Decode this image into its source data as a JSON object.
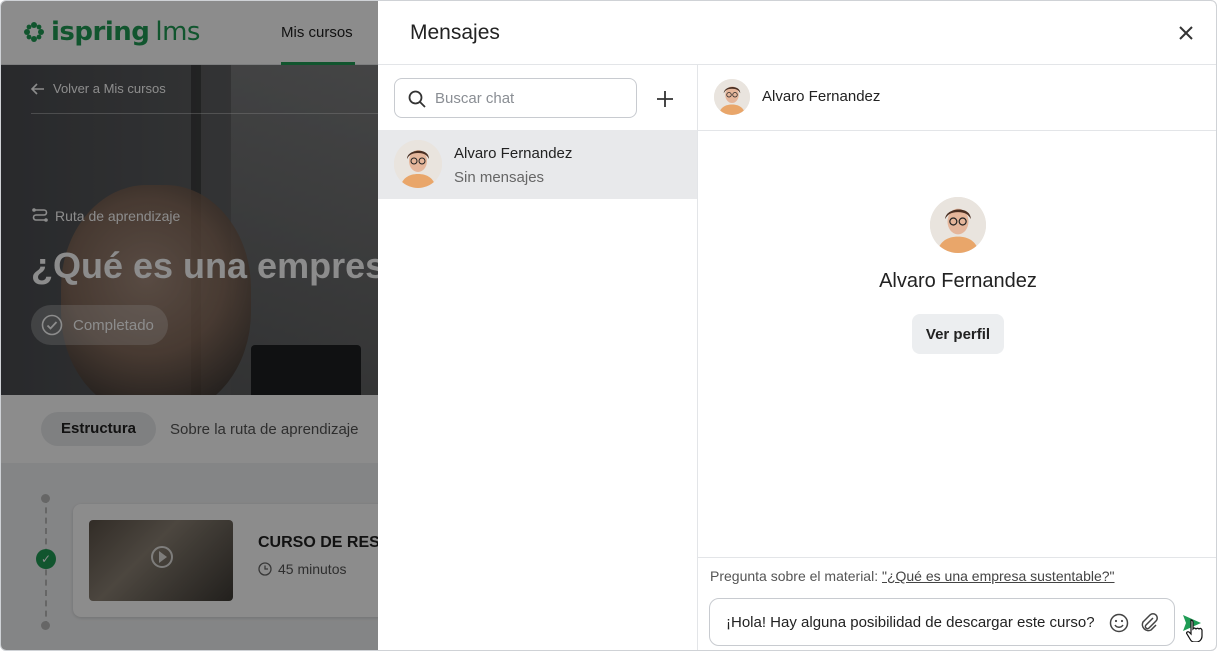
{
  "colors": {
    "brand": "#1f9c55",
    "send": "#1f9c55",
    "overlay": "rgba(0,0,0,0.45)"
  },
  "background": {
    "logo": {
      "name": "ispring",
      "suffix": "lms"
    },
    "nav": {
      "my_courses": "Mis cursos"
    },
    "hero": {
      "back_label": "Volver a Mis cursos",
      "route_label": "Ruta de aprendizaje",
      "title": "¿Qué es una empresa",
      "status": "Completado"
    },
    "tabs": {
      "structure": "Estructura",
      "about": "Sobre la ruta de aprendizaje"
    },
    "course": {
      "title": "CURSO DE RES",
      "duration": "45 minutos"
    }
  },
  "messages": {
    "title": "Mensajes",
    "search": {
      "placeholder": "Buscar chat"
    },
    "chats": [
      {
        "name": "Alvaro Fernandez",
        "preview": "Sin mensajes"
      }
    ],
    "conversation": {
      "contact_name": "Alvaro Fernandez",
      "view_profile": "Ver perfil",
      "reference_label": "Pregunta sobre el material:",
      "reference_link": "\"¿Qué es una empresa sustentable?\"",
      "draft": "¡Hola! Hay alguna posibilidad de descargar este curso?"
    }
  }
}
